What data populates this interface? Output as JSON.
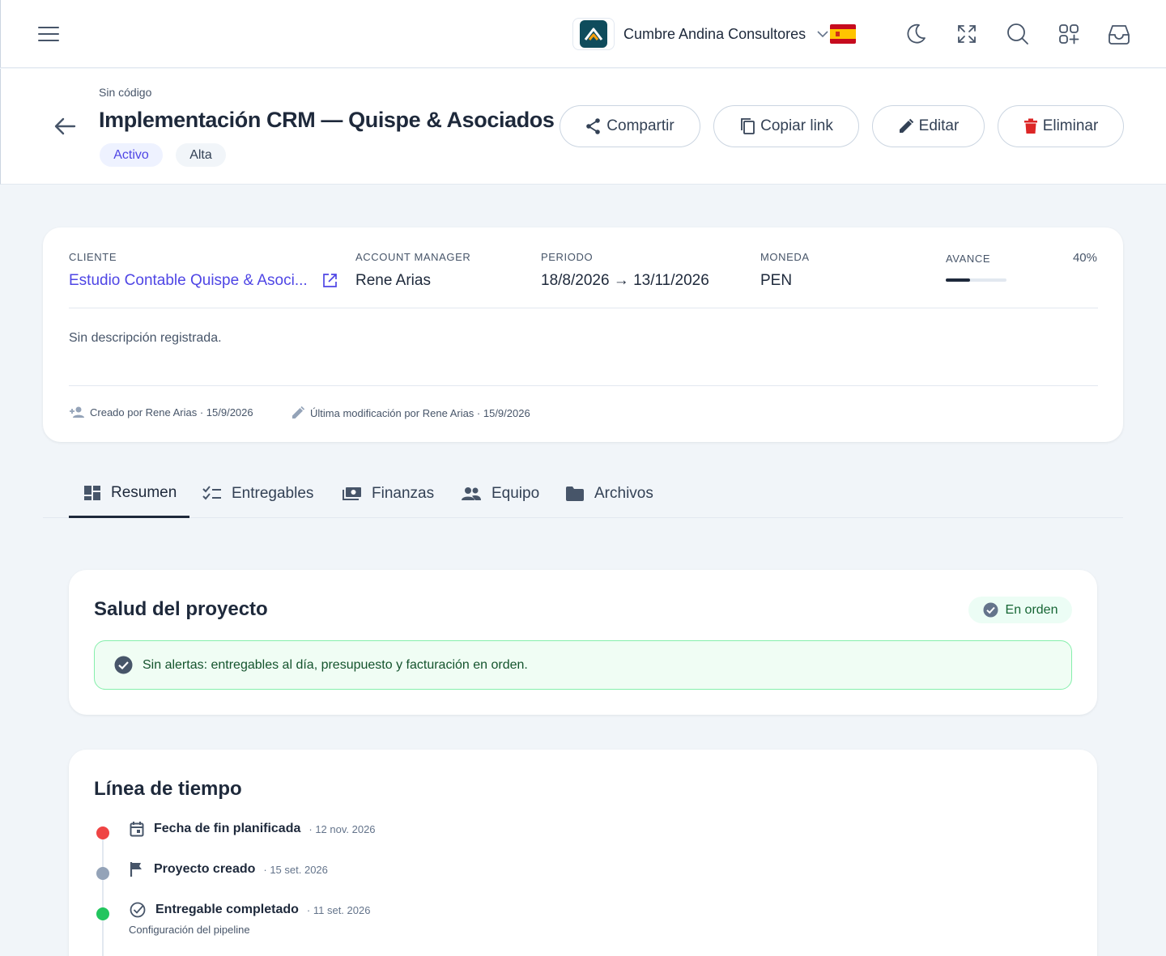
{
  "topbar": {
    "org_name": "Cumbre Andina Consultores",
    "accent": "#0f4c5c"
  },
  "header": {
    "code": "Sin código",
    "title": "Implementación CRM — Quispe & Asociados",
    "status_badge": "Activo",
    "priority_badge": "Alta",
    "buttons": {
      "share": "Compartir",
      "copy_link": "Copiar link",
      "edit": "Editar",
      "delete": "Eliminar"
    }
  },
  "info": {
    "client_label": "CLIENTE",
    "client_value": "Estudio Contable Quispe & Asoci...",
    "manager_label": "ACCOUNT MANAGER",
    "manager_value": "Rene Arias",
    "period_label": "PERIODO",
    "period_value": "18/8/2026 → 13/11/2026",
    "currency_label": "MONEDA",
    "currency_value": "PEN",
    "progress_label": "AVANCE",
    "progress_text": "40%",
    "progress_fraction": 0.4,
    "description": "Sin descripción registrada.",
    "created": "Creado por Rene Arias · 15/9/2026",
    "modified": "Última modificación por Rene Arias · 15/9/2026"
  },
  "tabs": [
    {
      "label": "Resumen",
      "icon": "dashboard-icon",
      "active": true
    },
    {
      "label": "Entregables",
      "icon": "checklist-icon",
      "active": false
    },
    {
      "label": "Finanzas",
      "icon": "payments-icon",
      "active": false
    },
    {
      "label": "Equipo",
      "icon": "group-icon",
      "active": false
    },
    {
      "label": "Archivos",
      "icon": "folder-icon",
      "active": false
    }
  ],
  "health": {
    "title": "Salud del proyecto",
    "status": "En orden",
    "message": "Sin alertas: entregables al día, presupuesto y facturación en orden."
  },
  "timeline": {
    "title": "Línea de tiempo",
    "items": [
      {
        "title": "Fecha de fin planificada",
        "date": "· 12 nov. 2026",
        "color": "#ef4444",
        "icon": "calendar-icon"
      },
      {
        "title": "Proyecto creado",
        "date": "· 15 set. 2026",
        "color": "#94a3b8",
        "icon": "flag-icon"
      },
      {
        "title": "Entregable completado",
        "date": "· 11 set. 2026",
        "color": "#22c55e",
        "icon": "check-circle-icon",
        "subtitle": "Configuración del pipeline"
      }
    ]
  }
}
